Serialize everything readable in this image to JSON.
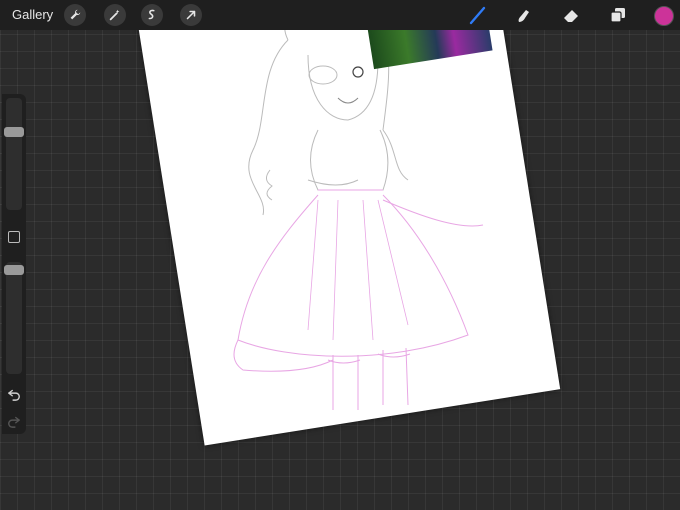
{
  "toolbar": {
    "gallery_label": "Gallery",
    "left_tools": [
      {
        "icon": "wrench-icon"
      },
      {
        "icon": "magic-wand-icon"
      },
      {
        "icon": "selection-icon"
      },
      {
        "icon": "transform-arrow-icon"
      }
    ],
    "right_tools": [
      {
        "icon": "brush-icon",
        "active": true
      },
      {
        "icon": "smudge-icon"
      },
      {
        "icon": "eraser-icon"
      },
      {
        "icon": "layers-icon"
      }
    ],
    "current_color": "#cc3399",
    "accent_color": "#2f7bf6"
  },
  "sidebar": {
    "brush_size_level": 0.28,
    "opacity_level": 0.03,
    "modify_button_icon": "square-icon",
    "undo_icon": "undo-icon",
    "redo_icon": "redo-icon"
  },
  "canvas": {
    "paper_color": "#ffffff",
    "sketch_line_color": "#bbbbbb",
    "dress_line_color": "#e8a6e4"
  }
}
